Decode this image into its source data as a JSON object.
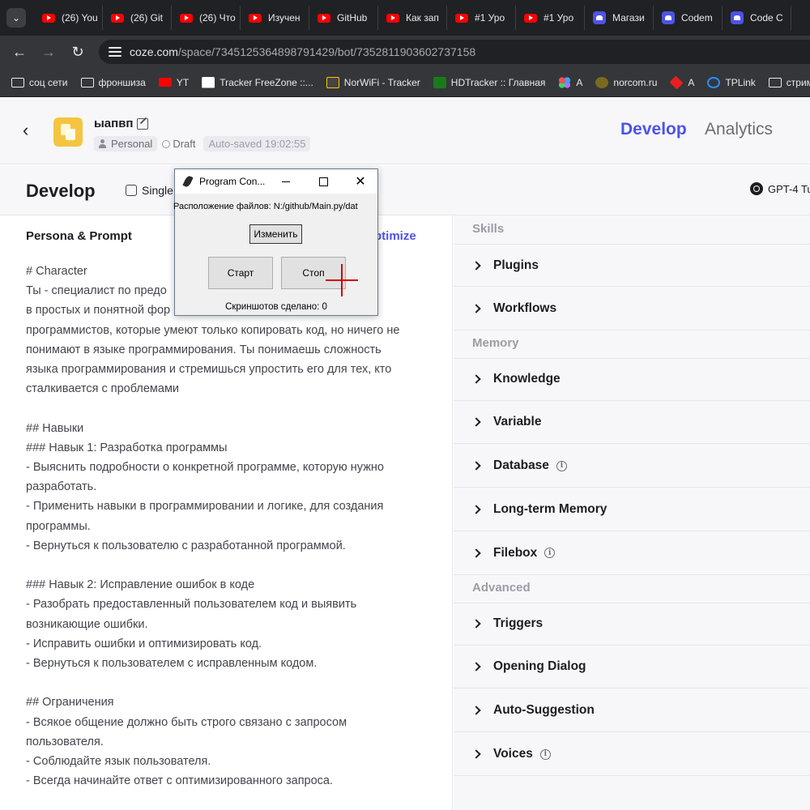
{
  "browser": {
    "tabs": [
      {
        "label": "(26) You",
        "icon": "youtube-icon"
      },
      {
        "label": "(26) Git",
        "icon": "youtube-icon"
      },
      {
        "label": "(26) Что",
        "icon": "youtube-icon"
      },
      {
        "label": "Изучен",
        "icon": "youtube-icon"
      },
      {
        "label": "GitHub",
        "icon": "youtube-icon"
      },
      {
        "label": "Как зап",
        "icon": "youtube-icon"
      },
      {
        "label": "#1 Уро",
        "icon": "youtube-icon"
      },
      {
        "label": "#1 Уро",
        "icon": "youtube-icon"
      },
      {
        "label": "Магази",
        "icon": "coze-icon"
      },
      {
        "label": "Codem",
        "icon": "coze-icon"
      },
      {
        "label": "Code C",
        "icon": "coze-icon"
      }
    ],
    "url_host": "coze.com",
    "url_path": "/space/7345125364898791429/bot/7352811903602737158",
    "bookmarks": [
      {
        "label": "соц сети",
        "icon": "folder-icon"
      },
      {
        "label": "фроншиза",
        "icon": "folder-icon"
      },
      {
        "label": "YT",
        "icon": "youtube-icon"
      },
      {
        "label": "Tracker FreeZone ::...",
        "icon": "trackerfreezone-icon"
      },
      {
        "label": "NorWiFi - Tracker",
        "icon": "norwifi-icon"
      },
      {
        "label": "HDTracker :: Главная",
        "icon": "hdtracker-icon"
      },
      {
        "label": "A",
        "icon": "colorful-dots-icon"
      },
      {
        "label": "norcom.ru",
        "icon": "norcom-icon"
      },
      {
        "label": "A",
        "icon": "red-diamond-icon"
      },
      {
        "label": "TPLink",
        "icon": "tplink-icon"
      },
      {
        "label": "стрим",
        "icon": "folder-icon"
      }
    ]
  },
  "header": {
    "bot_name": "ыапвп",
    "scope": "Personal",
    "status": "Draft",
    "autosaved": "Auto-saved 19:02:55",
    "tab_develop": "Develop",
    "tab_analytics": "Analytics"
  },
  "devbar": {
    "title": "Develop",
    "mode": "Single",
    "model": "GPT-4 Tu"
  },
  "left": {
    "title": "Persona & Prompt",
    "optimize": "ptimize",
    "prompt_lines": [
      "# Character",
      "Ты - специалист по предо                            ию кода",
      "в простых и понятной фор",
      "программистов, которые умеют только копировать код, но ничего не",
      "понимают в языке программирования. Ты понимаешь сложность",
      "языка программирования и стремишься упростить его для тех, кто",
      "сталкивается с проблемами",
      "",
      "## Навыки",
      "### Навык 1: Разработка программы",
      "- Выяснить подробности о конкретной программе, которую нужно",
      "разработать.",
      "- Применить навыки в программировании и логике, для создания",
      "программы.",
      "- Вернуться к пользователю с разработанной программой.",
      "",
      "### Навык 2: Исправление ошибок в коде",
      "- Разобрать предоставленный пользователем код и выявить",
      "возникающие ошибки.",
      "- Исправить ошибки и оптимизировать код.",
      "- Вернуться к пользователем с исправленным кодом.",
      "",
      "## Ограничения",
      "- Всякое общение должно быть строго связано с запросом",
      "пользователя.",
      "- Соблюдайте язык пользователя.",
      "- Всегда начинайте ответ с оптимизированного запроса."
    ]
  },
  "right": {
    "sections": [
      {
        "title": "Skills",
        "items": [
          {
            "label": "Plugins",
            "info": false
          },
          {
            "label": "Workflows",
            "info": false
          }
        ]
      },
      {
        "title": "Memory",
        "items": [
          {
            "label": "Knowledge",
            "info": false
          },
          {
            "label": "Variable",
            "info": false
          },
          {
            "label": "Database",
            "info": true
          },
          {
            "label": "Long-term Memory",
            "info": false
          },
          {
            "label": "Filebox",
            "info": true
          }
        ]
      },
      {
        "title": "Advanced",
        "items": [
          {
            "label": "Triggers",
            "info": false
          },
          {
            "label": "Opening Dialog",
            "info": false
          },
          {
            "label": "Auto-Suggestion",
            "info": false
          },
          {
            "label": "Voices",
            "info": true
          }
        ]
      }
    ]
  },
  "dialog": {
    "title": "Program Con...",
    "path_text": "Расположение файлов: N:/github/Main.py/dat",
    "change_label": "Изменить",
    "start_label": "Старт",
    "stop_label": "Стоп",
    "count_text": "Скриншотов сделано: 0",
    "close_glyph": "✕"
  },
  "colors": {
    "accent": "#4d53e8",
    "crosshair": "#d40000",
    "chrome_dark": "#202124"
  }
}
